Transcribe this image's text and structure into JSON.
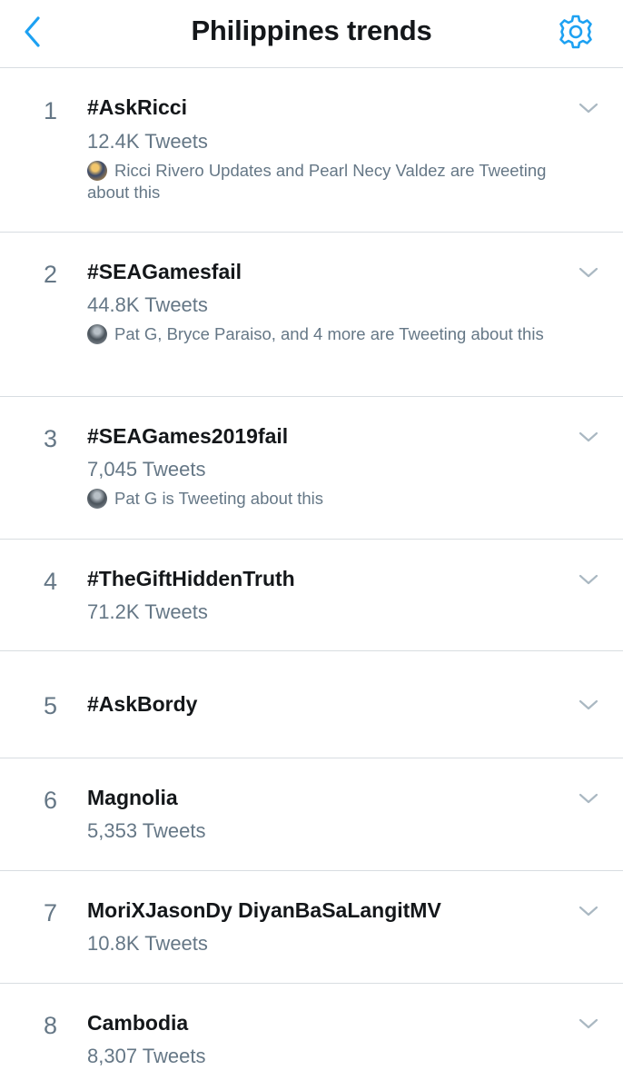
{
  "header": {
    "title": "Philippines trends",
    "back_icon": "chevron-left-icon",
    "settings_icon": "gear-icon",
    "accent_color": "#1da1f2"
  },
  "trends": [
    {
      "rank": "1",
      "name": "#AskRicci",
      "count": "12.4K Tweets",
      "context": "Ricci Rivero Updates and Pearl Necy Valdez are Tweeting about this"
    },
    {
      "rank": "2",
      "name": "#SEAGamesfail",
      "count": "44.8K Tweets",
      "context": "Pat G, Bryce Paraiso, and 4 more are Tweeting about this"
    },
    {
      "rank": "3",
      "name": "#SEAGames2019fail",
      "count": "7,045 Tweets",
      "context": "Pat G is Tweeting about this"
    },
    {
      "rank": "4",
      "name": "#TheGiftHiddenTruth",
      "count": "71.2K Tweets"
    },
    {
      "rank": "5",
      "name": "#AskBordy"
    },
    {
      "rank": "6",
      "name": "Magnolia",
      "count": "5,353 Tweets"
    },
    {
      "rank": "7",
      "name": "MoriXJasonDy DiyanBaSaLangitMV",
      "count": "10.8K Tweets"
    },
    {
      "rank": "8",
      "name": "Cambodia",
      "count": "8,307 Tweets"
    }
  ]
}
